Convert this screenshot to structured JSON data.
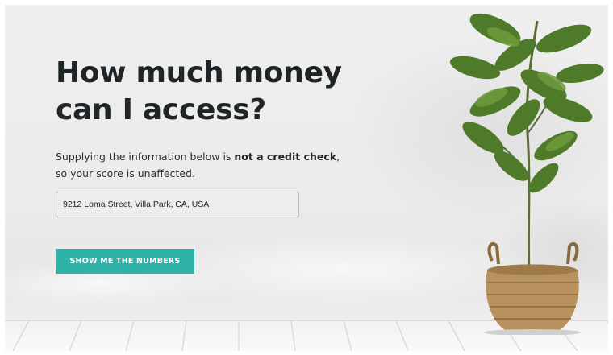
{
  "hero": {
    "heading_line1": "How much money",
    "heading_line2": "can I access?",
    "subtext_before": "Supplying the information below is ",
    "subtext_bold": "not a credit check",
    "subtext_after": ", so your score is unaffected."
  },
  "form": {
    "address_value": "9212 Loma Street, Villa Park, CA, USA",
    "submit_label": "SHOW ME THE NUMBERS"
  },
  "colors": {
    "accent": "#2fb3a8",
    "heading": "#1f2426",
    "background": "#ececec"
  },
  "decor": {
    "plant_icon": "potted-plant-icon",
    "floor": "wood-floor-planks"
  }
}
